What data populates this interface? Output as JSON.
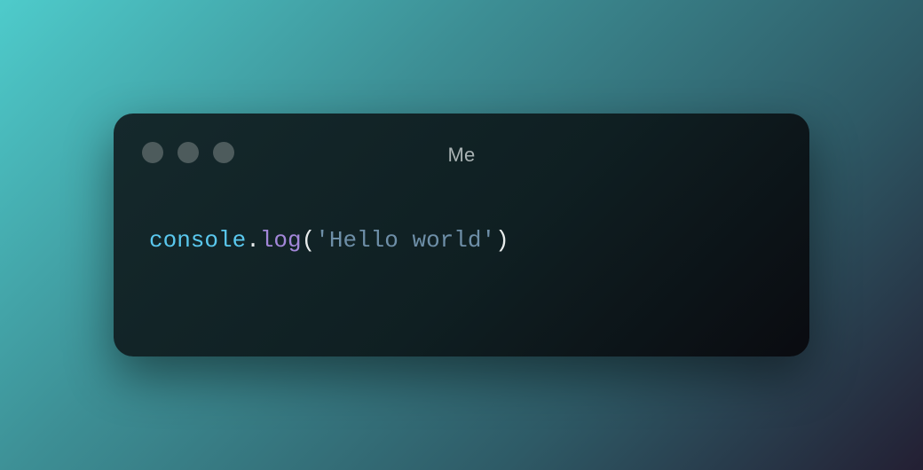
{
  "window": {
    "title": "Me"
  },
  "code": {
    "tokens": [
      {
        "text": "console",
        "kind": "object"
      },
      {
        "text": ".",
        "kind": "punct"
      },
      {
        "text": "log",
        "kind": "method"
      },
      {
        "text": "(",
        "kind": "punct"
      },
      {
        "text": "'Hello world'",
        "kind": "string"
      },
      {
        "text": ")",
        "kind": "punct"
      }
    ]
  },
  "colors": {
    "object": "#5ac8ee",
    "punct": "#e8ecec",
    "method": "#a387d9",
    "string": "#6e8fa8",
    "traffic_light": "#4d5b5c"
  }
}
